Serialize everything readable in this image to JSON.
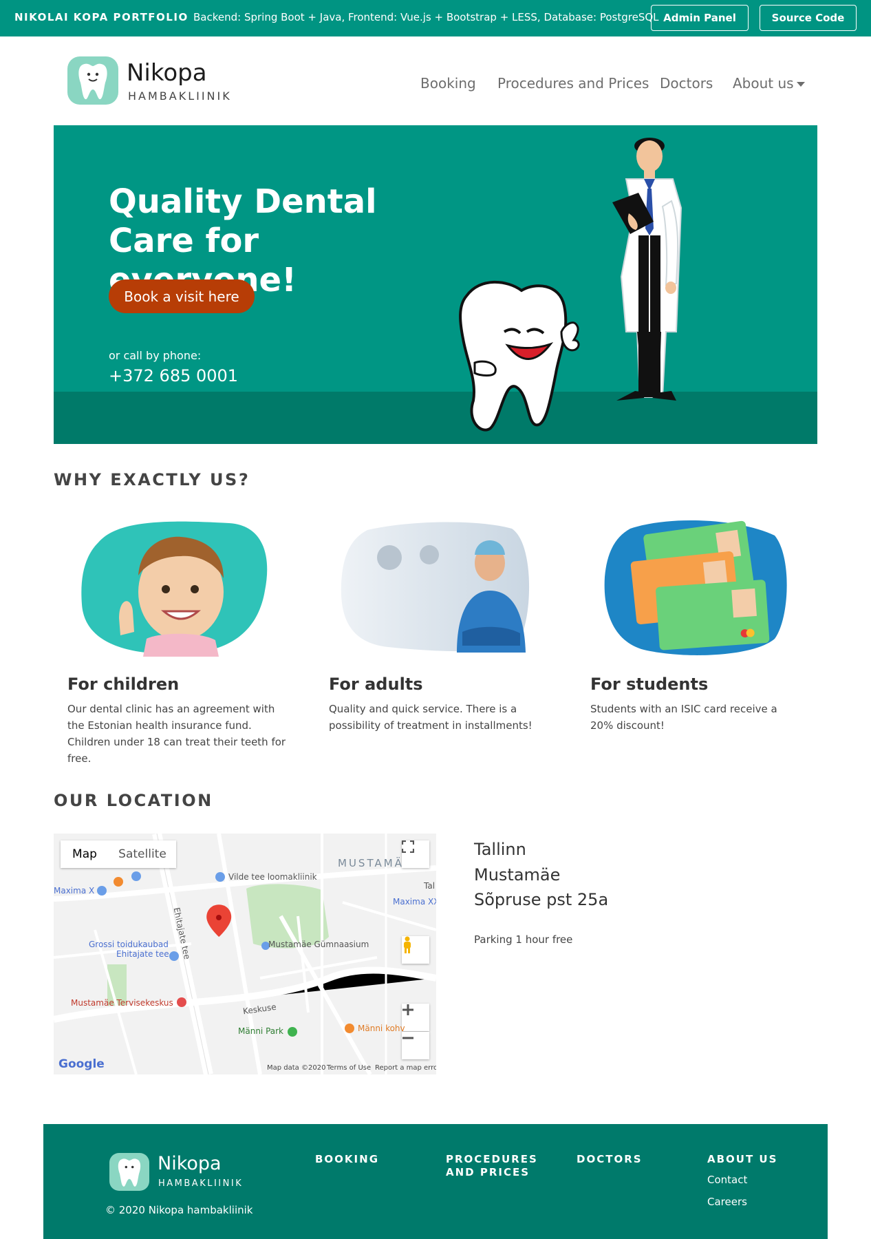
{
  "topbar": {
    "brand": "NIKOLAI KOPA PORTFOLIO",
    "stack": "Backend: Spring Boot + Java, Frontend: Vue.js + Bootstrap + LESS, Database: PostgreSQL",
    "admin_label": "Admin Panel",
    "source_label": "Source Code"
  },
  "header": {
    "logo_name": "Nikopa",
    "logo_sub": "HAMBAKLIINIK",
    "nav": {
      "booking": "Booking",
      "procedures": "Procedures and Prices",
      "doctors": "Doctors",
      "about": "About us"
    }
  },
  "hero": {
    "title": "Quality Dental Care for everyone!",
    "cta": "Book a visit here",
    "call_text": "or call by phone:",
    "phone": "+372 685 0001"
  },
  "why": {
    "title": "WHY EXACTLY US?",
    "features": [
      {
        "title": "For children",
        "text": "Our dental clinic has an agreement with the Estonian health insurance fund. Children under 18 can treat their teeth for free."
      },
      {
        "title": "For adults",
        "text": "Quality and quick service. There is a possibility of treatment in installments!"
      },
      {
        "title": "For students",
        "text": "Students with an ISIC card receive a 20% discount!"
      }
    ]
  },
  "location": {
    "title": "OUR LOCATION",
    "city": "Tallinn",
    "district": "Mustamäe",
    "street": "Sõpruse pst 25a",
    "parking": "Parking 1 hour free",
    "map": {
      "map_tab": "Map",
      "satellite_tab": "Satellite",
      "labels": {
        "mustamae": "MUSTAMÄ",
        "vilde": "Vilde tee loomakliinik",
        "maxima_x": "Maxima X",
        "maxima_xx": "Maxima XX",
        "grossi1": "Grossi toidukaubad",
        "grossi2": "Ehitajate tee",
        "gymnasium": "Mustamäe Gümnaasium",
        "tervise": "Mustamäe Tervisekeskus",
        "manni_park": "Männi Park",
        "manni_kohv": "Männi kohv",
        "keskuse": "Keskuse",
        "ehitajate": "Ehitajate tee",
        "tal": "Tal",
        "google": "Google",
        "map_data": "Map data ©2020",
        "terms": "Terms of Use",
        "report": "Report a map error"
      }
    }
  },
  "footer": {
    "logo_name": "Nikopa",
    "logo_sub": "HAMBAKLIINIK",
    "copyright": "© 2020 Nikopa hambakliinik",
    "col_booking": "BOOKING",
    "col_procedures_1": "PROCEDURES",
    "col_procedures_2": "AND PRICES",
    "col_doctors": "DOCTORS",
    "col_about": "ABOUT US",
    "link_contact": "Contact",
    "link_careers": "Careers"
  }
}
